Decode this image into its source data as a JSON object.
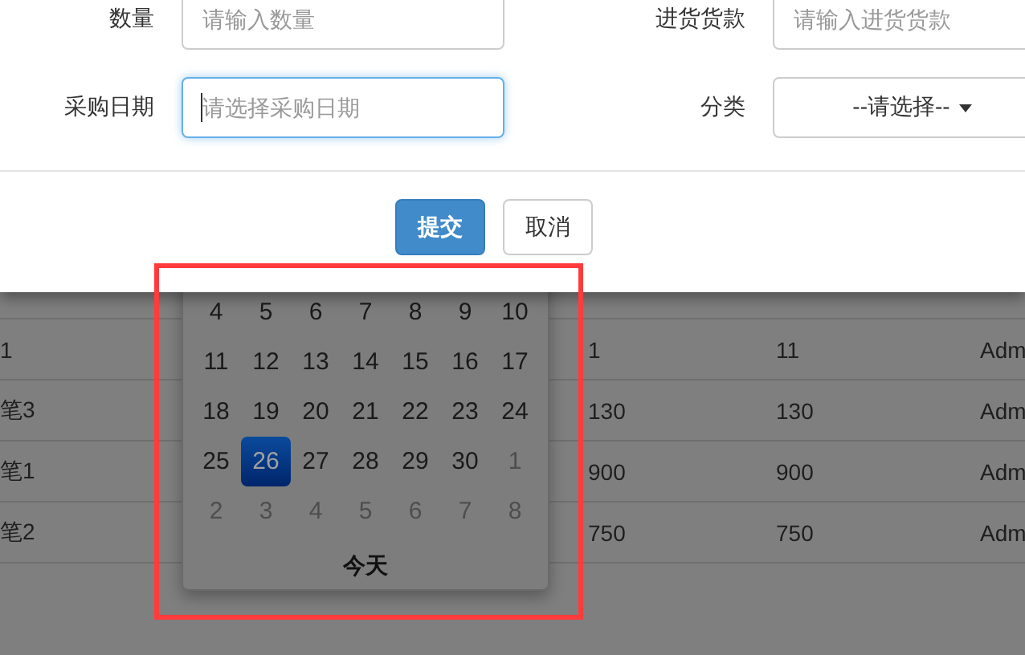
{
  "form": {
    "rows": [
      {
        "fields": [
          {
            "label": "数量",
            "kind": "input",
            "placeholder": "请输入数量",
            "focused": false
          },
          {
            "label": "进货货款",
            "kind": "input",
            "placeholder": "请输入进货货款",
            "focused": false
          }
        ]
      },
      {
        "fields": [
          {
            "label": "采购日期",
            "kind": "input",
            "placeholder": "请选择采购日期",
            "focused": true
          },
          {
            "label": "分类",
            "kind": "select",
            "value": "--请选择--"
          }
        ]
      }
    ]
  },
  "buttons": [
    {
      "label": "提交",
      "primary": true
    },
    {
      "label": "取消",
      "primary": false
    }
  ],
  "table": {
    "rows": [
      {
        "cells": [
          "1",
          "1",
          "11",
          "Adm"
        ]
      },
      {
        "cells": [
          "笔3",
          "130",
          "130",
          "Adm"
        ]
      },
      {
        "cells": [
          "笔1",
          "900",
          "900",
          "Adm"
        ]
      },
      {
        "cells": [
          "笔2",
          "750",
          "750",
          "Adm"
        ]
      }
    ]
  },
  "datepicker": {
    "weeks": [
      [
        {
          "day": "4",
          "other_month": false,
          "selected": false
        },
        {
          "day": "5",
          "other_month": false,
          "selected": false
        },
        {
          "day": "6",
          "other_month": false,
          "selected": false
        },
        {
          "day": "7",
          "other_month": false,
          "selected": false
        },
        {
          "day": "8",
          "other_month": false,
          "selected": false
        },
        {
          "day": "9",
          "other_month": false,
          "selected": false
        },
        {
          "day": "10",
          "other_month": false,
          "selected": false
        }
      ],
      [
        {
          "day": "11",
          "other_month": false,
          "selected": false
        },
        {
          "day": "12",
          "other_month": false,
          "selected": false
        },
        {
          "day": "13",
          "other_month": false,
          "selected": false
        },
        {
          "day": "14",
          "other_month": false,
          "selected": false
        },
        {
          "day": "15",
          "other_month": false,
          "selected": false
        },
        {
          "day": "16",
          "other_month": false,
          "selected": false
        },
        {
          "day": "17",
          "other_month": false,
          "selected": false
        }
      ],
      [
        {
          "day": "18",
          "other_month": false,
          "selected": false
        },
        {
          "day": "19",
          "other_month": false,
          "selected": false
        },
        {
          "day": "20",
          "other_month": false,
          "selected": false
        },
        {
          "day": "21",
          "other_month": false,
          "selected": false
        },
        {
          "day": "22",
          "other_month": false,
          "selected": false
        },
        {
          "day": "23",
          "other_month": false,
          "selected": false
        },
        {
          "day": "24",
          "other_month": false,
          "selected": false
        }
      ],
      [
        {
          "day": "25",
          "other_month": false,
          "selected": false
        },
        {
          "day": "26",
          "other_month": false,
          "selected": true
        },
        {
          "day": "27",
          "other_month": false,
          "selected": false
        },
        {
          "day": "28",
          "other_month": false,
          "selected": false
        },
        {
          "day": "29",
          "other_month": false,
          "selected": false
        },
        {
          "day": "30",
          "other_month": false,
          "selected": false
        },
        {
          "day": "1",
          "other_month": true,
          "selected": false
        }
      ],
      [
        {
          "day": "2",
          "other_month": true,
          "selected": false
        },
        {
          "day": "3",
          "other_month": true,
          "selected": false
        },
        {
          "day": "4",
          "other_month": true,
          "selected": false
        },
        {
          "day": "5",
          "other_month": true,
          "selected": false
        },
        {
          "day": "6",
          "other_month": true,
          "selected": false
        },
        {
          "day": "7",
          "other_month": true,
          "selected": false
        },
        {
          "day": "8",
          "other_month": true,
          "selected": false
        }
      ]
    ],
    "today_button": "今天"
  }
}
